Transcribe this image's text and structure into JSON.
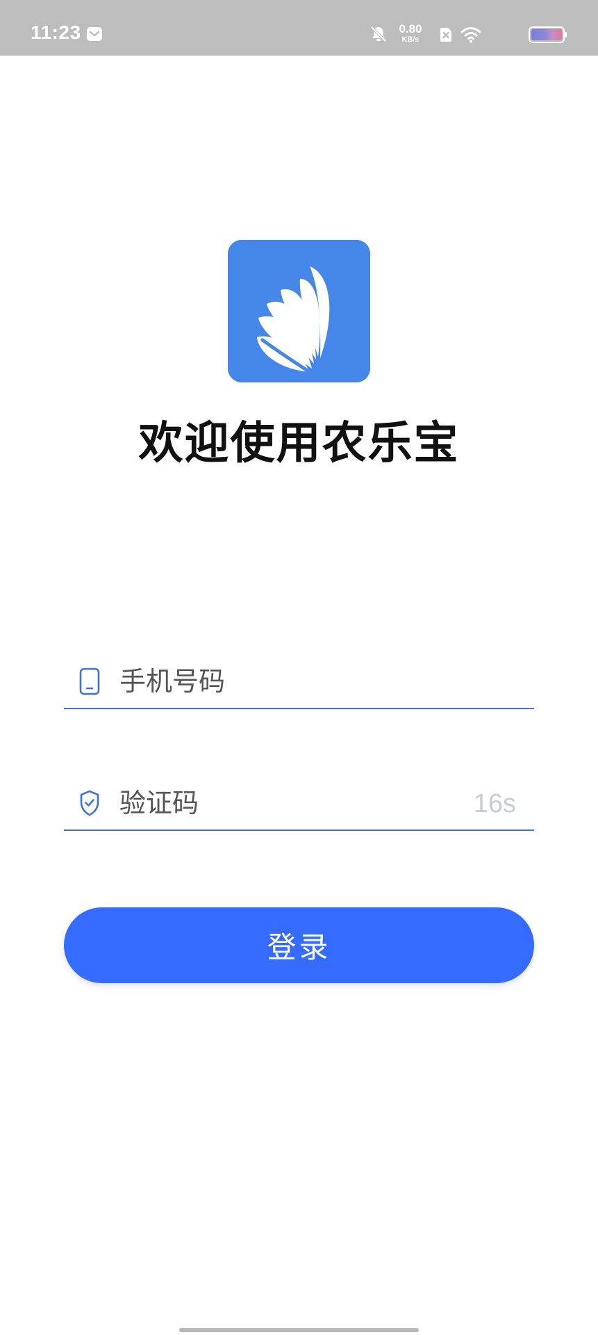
{
  "status_bar": {
    "time": "11:23",
    "net_speed_value": "0.80",
    "net_speed_unit": "KB/s",
    "icons": [
      "message-icon",
      "bell-muted-icon",
      "sim-off-icon",
      "wifi-icon",
      "battery-icon"
    ]
  },
  "app": {
    "logo_color": "#4586e8",
    "welcome_title": "欢迎使用农乐宝"
  },
  "form": {
    "phone": {
      "placeholder": "手机号码",
      "value": "",
      "icon": "phone-icon"
    },
    "code": {
      "placeholder": "验证码",
      "value": "",
      "icon": "shield-check-icon",
      "countdown": "16s"
    },
    "login_label": "登录"
  },
  "colors": {
    "accent": "#356bff",
    "underline": "#3c74dd",
    "status_bar_bg": "#bdbdbd"
  }
}
